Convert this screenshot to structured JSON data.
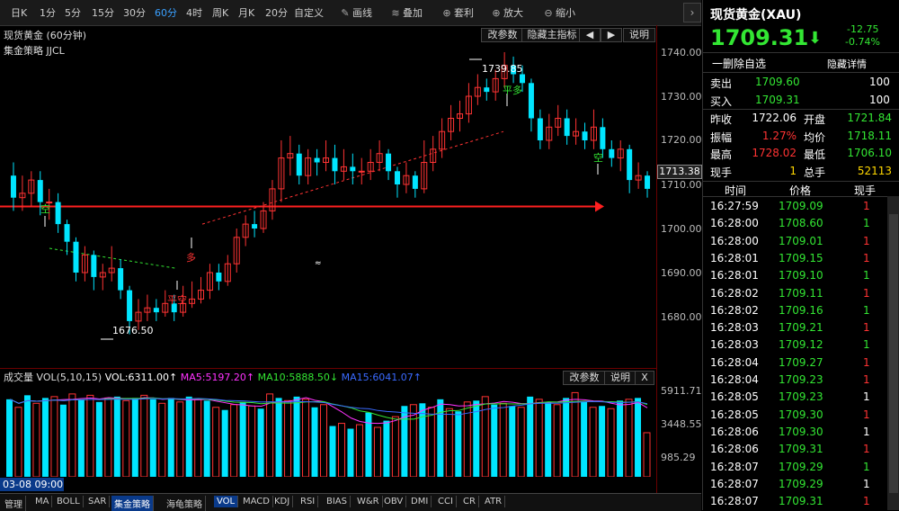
{
  "toolbar": {
    "items": [
      "日K",
      "1分",
      "5分",
      "15分",
      "30分",
      "60分",
      "4时",
      "周K",
      "月K",
      "20分",
      "自定义",
      "画线",
      "叠加",
      "套利",
      "放大",
      "缩小"
    ],
    "active": "60分",
    "icons": {
      "画线": "pencil-icon",
      "叠加": "layers-icon",
      "套利": "arbitrage-icon",
      "放大": "zoom-in-icon",
      "缩小": "zoom-out-icon"
    },
    "collapse_glyph": "›"
  },
  "chart": {
    "title": "现货黄金 (60分钟)",
    "strategy": "集金策略 JJCL",
    "buttons": {
      "edit_params": "改参数",
      "hide_strategy": "隐藏主指标",
      "prev": "◀",
      "next": "▶",
      "help": "说明"
    },
    "y_ticks": [
      "1740.00",
      "1730.00",
      "1720.00",
      "1710.00",
      "1700.00",
      "1690.00",
      "1680.00"
    ],
    "current_price_tag": "1713.38",
    "annotations": {
      "high": "1739.85",
      "low": "1676.50",
      "kong1": "空",
      "duo": "多",
      "pingkong": "平空",
      "pingduo": "平多",
      "kong2": "空",
      "marker": "≈"
    }
  },
  "chart_data": {
    "type": "candlestick",
    "ylim": [
      1670,
      1745
    ],
    "candles": [
      [
        1712,
        1707,
        1715,
        1704
      ],
      [
        1707,
        1708,
        1712,
        1704
      ],
      [
        1708,
        1711,
        1713,
        1705
      ],
      [
        1711,
        1706,
        1713,
        1703
      ],
      [
        1706,
        1706,
        1709,
        1702
      ],
      [
        1706,
        1701,
        1708,
        1699
      ],
      [
        1701,
        1697,
        1702,
        1694
      ],
      [
        1697,
        1690,
        1698,
        1688
      ],
      [
        1690,
        1694,
        1696,
        1688
      ],
      [
        1694,
        1689,
        1695,
        1686
      ],
      [
        1689,
        1690,
        1692,
        1686
      ],
      [
        1690,
        1691,
        1696,
        1688
      ],
      [
        1691,
        1686,
        1693,
        1684
      ],
      [
        1686,
        1679,
        1687,
        1676
      ],
      [
        1679,
        1681,
        1684,
        1677
      ],
      [
        1681,
        1682,
        1685,
        1679
      ],
      [
        1682,
        1681,
        1684,
        1679
      ],
      [
        1681,
        1683,
        1686,
        1680
      ],
      [
        1683,
        1681,
        1685,
        1679
      ],
      [
        1681,
        1683,
        1687,
        1680
      ],
      [
        1683,
        1684,
        1688,
        1682
      ],
      [
        1684,
        1686,
        1689,
        1683
      ],
      [
        1686,
        1690,
        1692,
        1684
      ],
      [
        1690,
        1688,
        1692,
        1686
      ],
      [
        1688,
        1692,
        1694,
        1687
      ],
      [
        1692,
        1698,
        1700,
        1690
      ],
      [
        1698,
        1701,
        1703,
        1696
      ],
      [
        1701,
        1700,
        1704,
        1698
      ],
      [
        1700,
        1704,
        1706,
        1699
      ],
      [
        1704,
        1709,
        1711,
        1702
      ],
      [
        1709,
        1716,
        1720,
        1706
      ],
      [
        1716,
        1717,
        1721,
        1712
      ],
      [
        1717,
        1712,
        1719,
        1710
      ],
      [
        1712,
        1716,
        1718,
        1710
      ],
      [
        1716,
        1715,
        1718,
        1712
      ],
      [
        1715,
        1716,
        1720,
        1713
      ],
      [
        1716,
        1713,
        1719,
        1710
      ],
      [
        1713,
        1714,
        1718,
        1711
      ],
      [
        1714,
        1713,
        1717,
        1710
      ],
      [
        1713,
        1713,
        1716,
        1710
      ],
      [
        1713,
        1715,
        1718,
        1711
      ],
      [
        1715,
        1717,
        1720,
        1713
      ],
      [
        1717,
        1713,
        1718,
        1711
      ],
      [
        1713,
        1710,
        1714,
        1707
      ],
      [
        1710,
        1712,
        1715,
        1708
      ],
      [
        1712,
        1709,
        1713,
        1707
      ],
      [
        1709,
        1715,
        1720,
        1708
      ],
      [
        1715,
        1718,
        1721,
        1713
      ],
      [
        1718,
        1722,
        1725,
        1716
      ],
      [
        1722,
        1725,
        1728,
        1720
      ],
      [
        1725,
        1726,
        1729,
        1722
      ],
      [
        1726,
        1730,
        1733,
        1724
      ],
      [
        1730,
        1732,
        1735,
        1728
      ],
      [
        1732,
        1731,
        1734,
        1729
      ],
      [
        1731,
        1734,
        1736,
        1729
      ],
      [
        1734,
        1737,
        1740,
        1732
      ],
      [
        1737,
        1735,
        1739,
        1733
      ],
      [
        1735,
        1733,
        1737,
        1731
      ],
      [
        1733,
        1725,
        1734,
        1722
      ],
      [
        1725,
        1720,
        1727,
        1718
      ],
      [
        1720,
        1723,
        1726,
        1718
      ],
      [
        1723,
        1725,
        1728,
        1721
      ],
      [
        1725,
        1721,
        1727,
        1719
      ],
      [
        1721,
        1722,
        1725,
        1719
      ],
      [
        1722,
        1720,
        1724,
        1718
      ],
      [
        1720,
        1723,
        1727,
        1718
      ],
      [
        1723,
        1718,
        1725,
        1716
      ],
      [
        1718,
        1716,
        1720,
        1714
      ],
      [
        1716,
        1718,
        1720,
        1713
      ],
      [
        1718,
        1711,
        1719,
        1708
      ],
      [
        1711,
        1712,
        1715,
        1709
      ],
      [
        1712,
        1709,
        1713,
        1707
      ]
    ],
    "markers": {
      "resistance_price": 1705,
      "dashed_green": [
        1695.5,
        1691
      ],
      "dashed_red": [
        1701,
        1722
      ]
    },
    "volume": {
      "ylim": [
        0,
        7000
      ],
      "ticks": [
        "5911.71",
        "3448.55",
        "985.29"
      ],
      "bars": [
        5800,
        5200,
        6100,
        5500,
        5900,
        6000,
        5400,
        6200,
        5800,
        6100,
        5600,
        5900,
        6000,
        5700,
        5900,
        6100,
        5800,
        5500,
        5900,
        5600,
        6000,
        5800,
        5700,
        5200,
        5000,
        5400,
        5600,
        5300,
        5100,
        6200,
        5900,
        5700,
        6000,
        5800,
        5200,
        5400,
        3800,
        4000,
        3600,
        3900,
        4800,
        3700,
        4200,
        4500,
        5300,
        5400,
        5500,
        5200,
        5800,
        5100,
        4900,
        5600,
        5700,
        6000,
        5400,
        5500,
        5300,
        5200,
        6000,
        5800,
        5600,
        5400,
        5900,
        6300,
        5600,
        5200,
        5300,
        5100,
        5700,
        5800,
        5900,
        3300
      ],
      "colors": "alternating red up, cyan down"
    }
  },
  "volume_panel": {
    "label": "成交量",
    "vol_params": "VOL(5,10,15)",
    "vol_value": "VOL:6311.00↑",
    "ma5": "MA5:5197.20↑",
    "ma10": "MA10:5888.50↓",
    "ma15": "MA15:6041.07↑",
    "buttons": {
      "edit_params": "改参数",
      "help": "说明",
      "close": "X"
    }
  },
  "bottom": {
    "date": "03-08 09:00",
    "tabs": [
      "管理",
      "MA",
      "BOLL",
      "SAR",
      "集金策略",
      "海龟策略",
      "VOL",
      "MACD",
      "KDJ",
      "RSI",
      "BIAS",
      "W&R",
      "OBV",
      "DMI",
      "CCI",
      "CR",
      "ATR"
    ],
    "active_tab": "集金策略",
    "active_tab2": "VOL"
  },
  "quote": {
    "name": "现货黄金(XAU)",
    "price": "1709.31",
    "arrow": "⬇",
    "change": "-12.75",
    "change_pct": "-0.74%",
    "actions": {
      "remove_watch": "一删除自选",
      "hide_detail": "隐藏详情"
    },
    "sell_label": "卖出",
    "sell_price": "1709.60",
    "sell_qty": "100",
    "buy_label": "买入",
    "buy_price": "1709.31",
    "buy_qty": "100",
    "stats": [
      {
        "l1": "昨收",
        "v1": "1722.06",
        "c1": "white",
        "l2": "开盘",
        "v2": "1721.84",
        "c2": "green"
      },
      {
        "l1": "振幅",
        "v1": "1.27%",
        "c1": "red",
        "l2": "均价",
        "v2": "1718.11",
        "c2": "green"
      },
      {
        "l1": "最高",
        "v1": "1728.02",
        "c1": "red",
        "l2": "最低",
        "v2": "1706.10",
        "c2": "green"
      },
      {
        "l1": "现手",
        "v1": "1",
        "c1": "yellow",
        "l2": "总手",
        "v2": "52113",
        "c2": "yellow"
      }
    ],
    "tick_headers": [
      "时间",
      "价格",
      "现手"
    ],
    "ticks": [
      {
        "t": "16:27:59",
        "p": "1709.09",
        "q": "1",
        "qc": "red"
      },
      {
        "t": "16:28:00",
        "p": "1708.60",
        "q": "1",
        "qc": "green"
      },
      {
        "t": "16:28:00",
        "p": "1709.01",
        "q": "1",
        "qc": "red"
      },
      {
        "t": "16:28:01",
        "p": "1709.15",
        "q": "1",
        "qc": "red"
      },
      {
        "t": "16:28:01",
        "p": "1709.10",
        "q": "1",
        "qc": "green"
      },
      {
        "t": "16:28:02",
        "p": "1709.11",
        "q": "1",
        "qc": "red"
      },
      {
        "t": "16:28:02",
        "p": "1709.16",
        "q": "1",
        "qc": "green"
      },
      {
        "t": "16:28:03",
        "p": "1709.21",
        "q": "1",
        "qc": "red"
      },
      {
        "t": "16:28:03",
        "p": "1709.12",
        "q": "1",
        "qc": "green"
      },
      {
        "t": "16:28:04",
        "p": "1709.27",
        "q": "1",
        "qc": "red"
      },
      {
        "t": "16:28:04",
        "p": "1709.23",
        "q": "1",
        "qc": "red"
      },
      {
        "t": "16:28:05",
        "p": "1709.23",
        "q": "1",
        "qc": "white"
      },
      {
        "t": "16:28:05",
        "p": "1709.30",
        "q": "1",
        "qc": "red"
      },
      {
        "t": "16:28:06",
        "p": "1709.30",
        "q": "1",
        "qc": "white"
      },
      {
        "t": "16:28:06",
        "p": "1709.31",
        "q": "1",
        "qc": "red"
      },
      {
        "t": "16:28:07",
        "p": "1709.29",
        "q": "1",
        "qc": "green"
      },
      {
        "t": "16:28:07",
        "p": "1709.29",
        "q": "1",
        "qc": "white"
      },
      {
        "t": "16:28:07",
        "p": "1709.31",
        "q": "1",
        "qc": "red"
      }
    ]
  },
  "colors": {
    "up": "#ff3333",
    "down": "#00e5ff",
    "accent": "#3aa0ff",
    "green": "#33e633"
  }
}
